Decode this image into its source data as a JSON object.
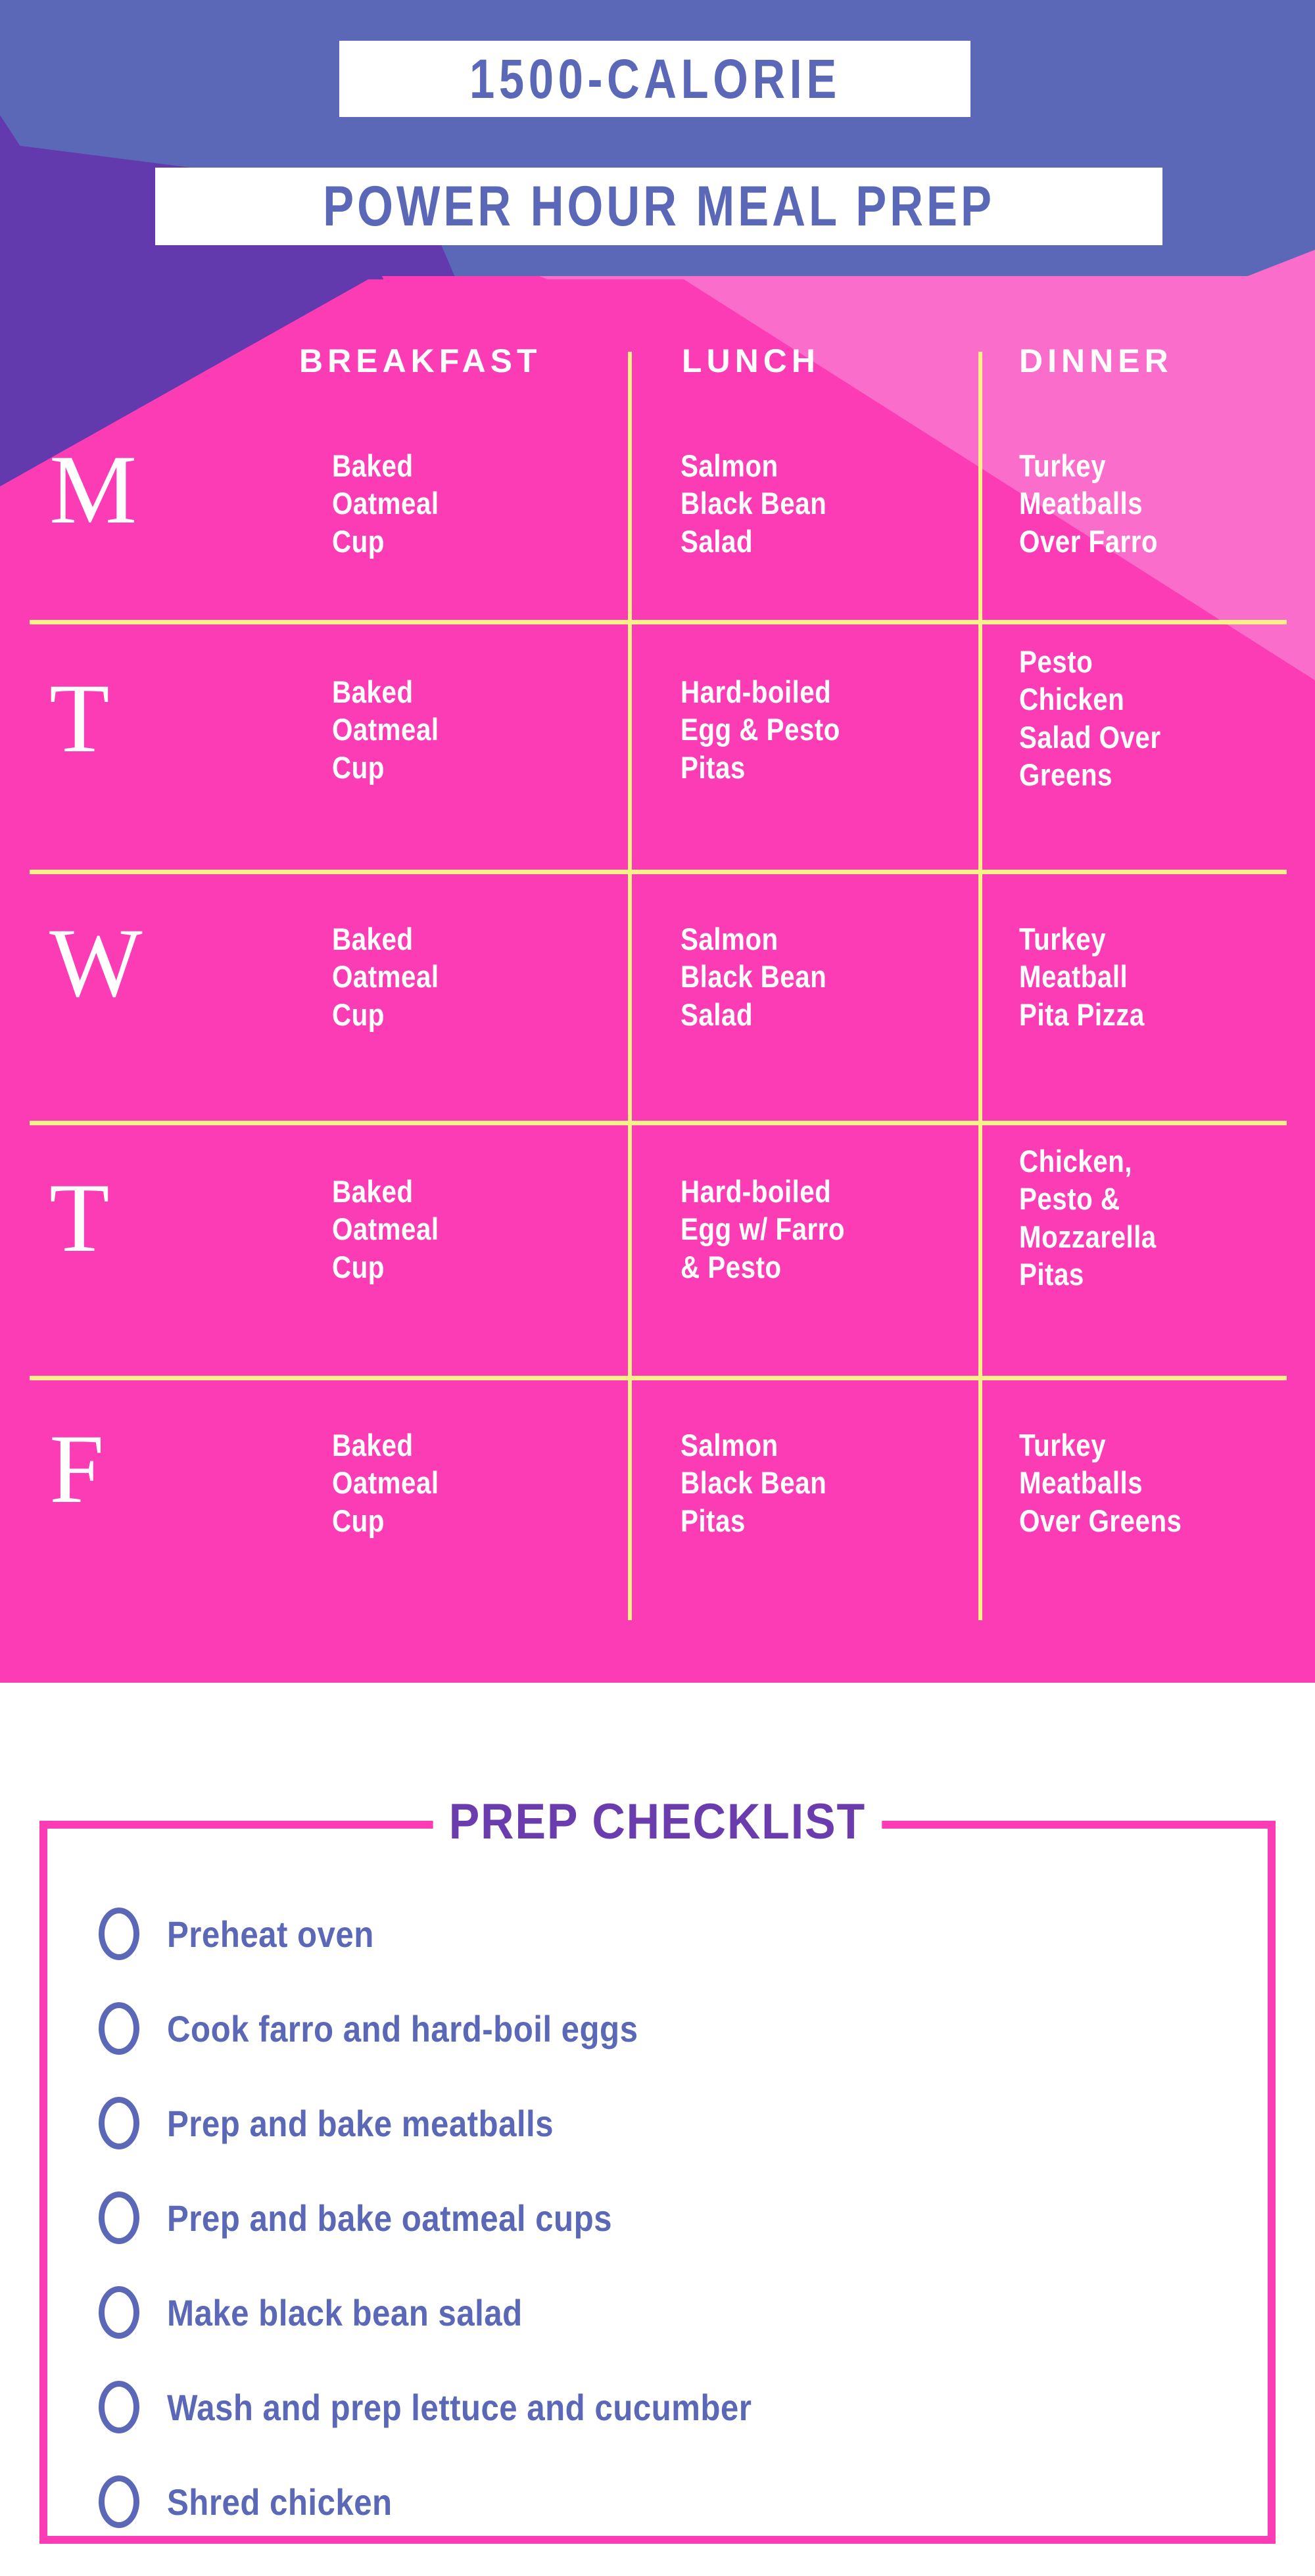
{
  "header": {
    "title_line_1": "1500-CALORIE",
    "title_line_2": "POWER HOUR MEAL PREP",
    "colors": {
      "periwinkle": "#5B68B8",
      "dark_purple": "#633AAE",
      "hot_pink": "#FB3CB5",
      "light_pink": "#FA6DCA",
      "white": "#FFFFFF",
      "yellow_divider": "#FAF08A"
    }
  },
  "meal_table": {
    "columns": [
      "BREAKFAST",
      "LUNCH",
      "DINNER"
    ],
    "rows": [
      {
        "day": "M",
        "breakfast": "Baked\nOatmeal\nCup",
        "lunch": "Salmon\nBlack Bean\nSalad",
        "dinner": "Turkey\nMeatballs\nOver Farro"
      },
      {
        "day": "T",
        "breakfast": "Baked\nOatmeal\nCup",
        "lunch": "Hard-boiled\nEgg & Pesto\nPitas",
        "dinner": "Pesto\nChicken\nSalad Over\nGreens"
      },
      {
        "day": "W",
        "breakfast": "Baked\nOatmeal\nCup",
        "lunch": "Salmon\nBlack Bean\nSalad",
        "dinner": "Turkey\nMeatball\nPita Pizza"
      },
      {
        "day": "T",
        "breakfast": "Baked\nOatmeal\nCup",
        "lunch": "Hard-boiled\nEgg w/ Farro\n& Pesto",
        "dinner": "Chicken,\nPesto &\nMozzarella\nPitas"
      },
      {
        "day": "F",
        "breakfast": "Baked\nOatmeal\nCup",
        "lunch": "Salmon\nBlack Bean\nPitas",
        "dinner": "Turkey\nMeatballs\nOver Greens"
      }
    ]
  },
  "checklist": {
    "title": "PREP CHECKLIST",
    "items": [
      {
        "label": "Preheat oven"
      },
      {
        "label": "Cook farro and hard-boil eggs"
      },
      {
        "label": "Prep and bake meatballs"
      },
      {
        "label": "Prep and bake oatmeal cups"
      },
      {
        "label": "Make black bean salad"
      },
      {
        "label": "Wash and prep lettuce and cucumber"
      },
      {
        "label": "Shred chicken"
      }
    ]
  }
}
